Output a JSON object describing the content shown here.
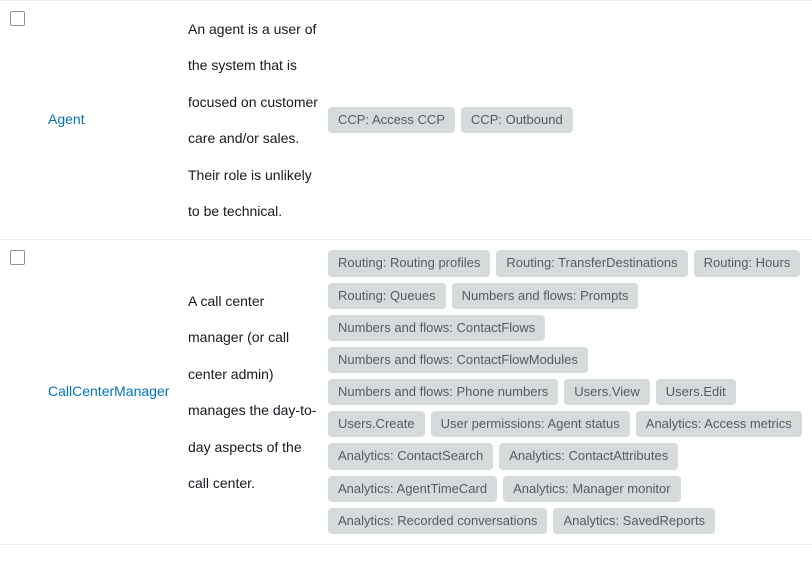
{
  "rows": [
    {
      "name": "Agent",
      "description": "An agent is a user of the system that is focused on customer care and/or sales. Their role is unlikely to be technical.",
      "permissions": [
        "CCP: Access CCP",
        "CCP: Outbound"
      ]
    },
    {
      "name": "CallCenterManager",
      "description": "A call center manager (or call center admin) manages the day-to-day aspects of the call center.",
      "permissions": [
        "Routing: Routing profiles",
        "Routing: TransferDestinations",
        "Routing: Hours",
        "Routing: Queues",
        "Numbers and flows: Prompts",
        "Numbers and flows: ContactFlows",
        "Numbers and flows: ContactFlowModules",
        "Numbers and flows: Phone numbers",
        "Users.View",
        "Users.Edit",
        "Users.Create",
        "User permissions: Agent status",
        "Analytics: Access metrics",
        "Analytics: ContactSearch",
        "Analytics: ContactAttributes",
        "Analytics: AgentTimeCard",
        "Analytics: Manager monitor",
        "Analytics: Recorded conversations",
        "Analytics: SavedReports"
      ]
    }
  ]
}
